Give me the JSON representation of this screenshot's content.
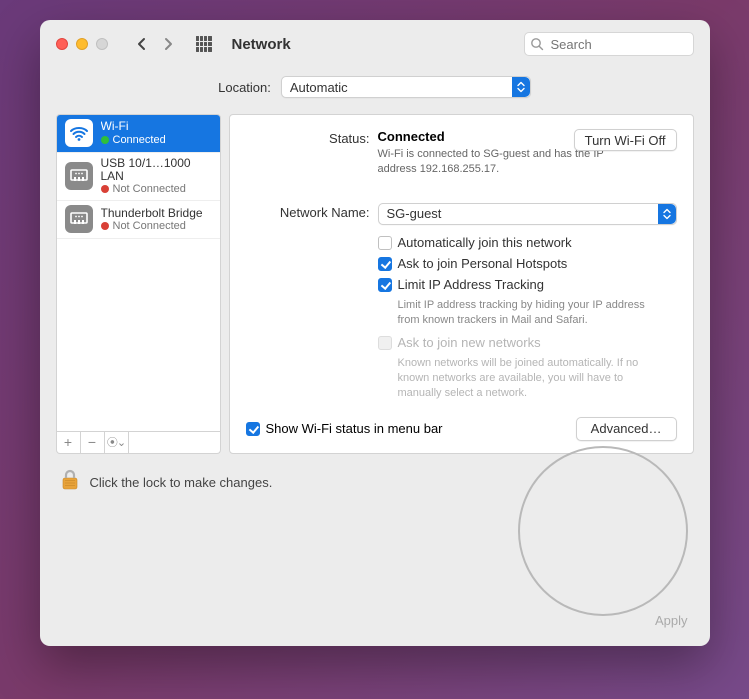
{
  "window": {
    "title": "Network"
  },
  "search": {
    "placeholder": "Search"
  },
  "location": {
    "label": "Location:",
    "value": "Automatic"
  },
  "sidebar": {
    "items": [
      {
        "name": "Wi-Fi",
        "status": "Connected",
        "dot": "green",
        "icon": "wifi",
        "selected": true
      },
      {
        "name": "USB 10/1…1000 LAN",
        "status": "Not Connected",
        "dot": "red",
        "icon": "ethernet",
        "selected": false
      },
      {
        "name": "Thunderbolt Bridge",
        "status": "Not Connected",
        "dot": "red",
        "icon": "thunderbolt",
        "selected": false
      }
    ]
  },
  "main": {
    "status_label": "Status:",
    "status_value": "Connected",
    "status_help": "Wi-Fi is connected to SG-guest and has the IP address 192.168.255.17.",
    "toggle_wifi": "Turn Wi-Fi Off",
    "network_name_label": "Network Name:",
    "network_name_value": "SG-guest",
    "checkboxes": {
      "auto_join": {
        "label": "Automatically join this network",
        "checked": false
      },
      "hotspots": {
        "label": "Ask to join Personal Hotspots",
        "checked": true
      },
      "limit_ip": {
        "label": "Limit IP Address Tracking",
        "checked": true,
        "sub": "Limit IP address tracking by hiding your IP address from known trackers in Mail and Safari."
      },
      "ask_new": {
        "label": "Ask to join new networks",
        "checked": false,
        "disabled": true,
        "sub": "Known networks will be joined automatically. If no known networks are available, you will have to manually select a network."
      }
    },
    "show_status_menubar": {
      "label": "Show Wi-Fi status in menu bar",
      "checked": true
    },
    "advanced": "Advanced…"
  },
  "footer": {
    "lock_text": "Click the lock to make changes.",
    "apply": "Apply"
  }
}
